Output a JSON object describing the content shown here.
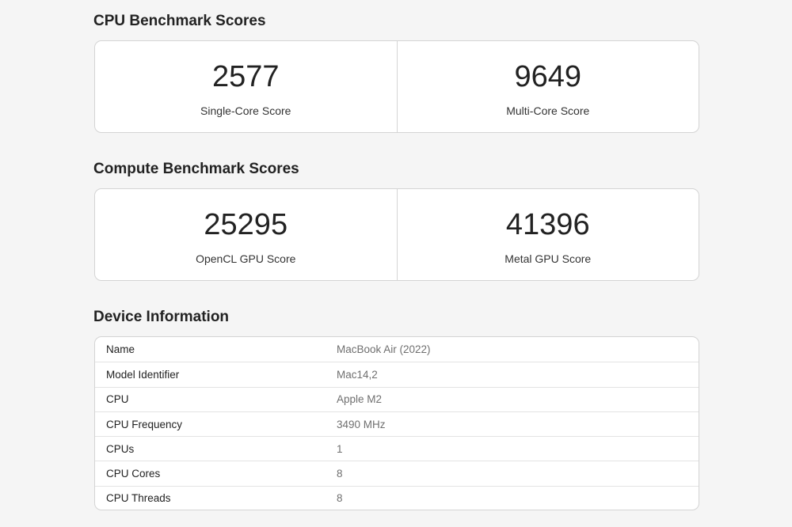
{
  "cpu_section": {
    "title": "CPU Benchmark Scores",
    "scores": [
      {
        "value": "2577",
        "label": "Single-Core Score"
      },
      {
        "value": "9649",
        "label": "Multi-Core Score"
      }
    ]
  },
  "compute_section": {
    "title": "Compute Benchmark Scores",
    "scores": [
      {
        "value": "25295",
        "label": "OpenCL GPU Score"
      },
      {
        "value": "41396",
        "label": "Metal GPU Score"
      }
    ]
  },
  "device_section": {
    "title": "Device Information",
    "rows": [
      {
        "key": "Name",
        "value": "MacBook Air (2022)"
      },
      {
        "key": "Model Identifier",
        "value": "Mac14,2"
      },
      {
        "key": "CPU",
        "value": "Apple M2"
      },
      {
        "key": "CPU Frequency",
        "value": "3490 MHz"
      },
      {
        "key": "CPUs",
        "value": "1"
      },
      {
        "key": "CPU Cores",
        "value": "8"
      },
      {
        "key": "CPU Threads",
        "value": "8"
      }
    ]
  }
}
